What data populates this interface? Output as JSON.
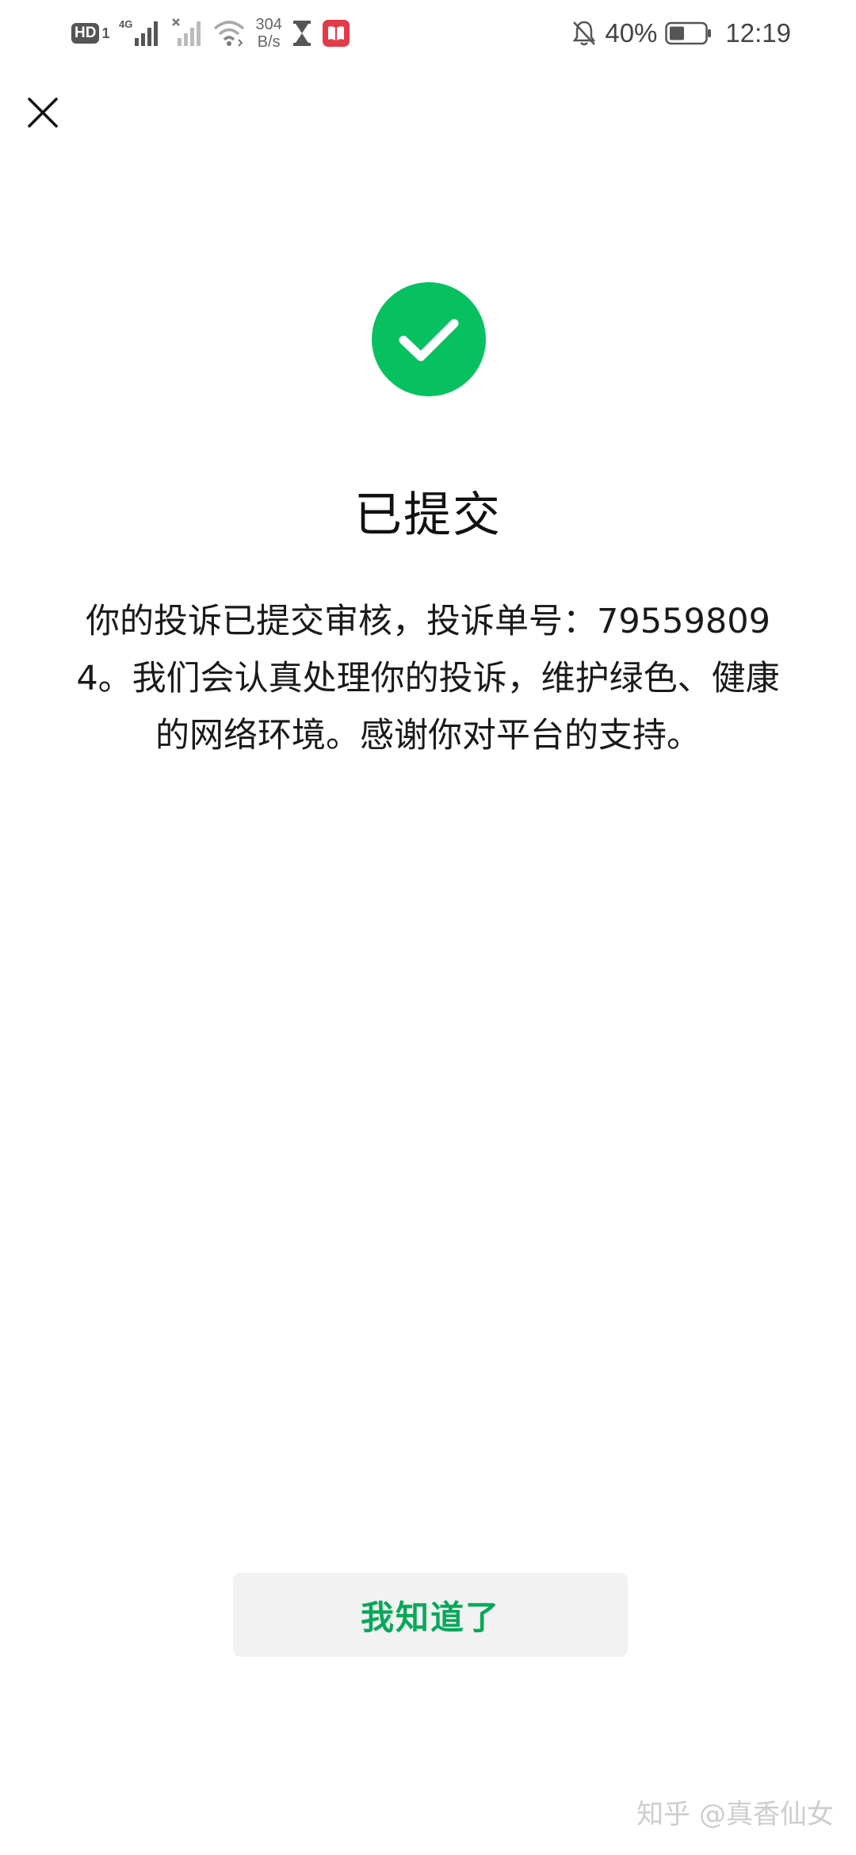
{
  "status_bar": {
    "hd_label": "HD",
    "hd_sub": "1",
    "network_type": "4G",
    "net_speed_value": "304",
    "net_speed_unit": "B/s",
    "battery_percent": "40%",
    "time": "12:19",
    "icons": [
      "hd-icon",
      "signal-4g-icon",
      "signal-no-service-icon",
      "wifi-icon",
      "hourglass-icon",
      "book-app-icon",
      "bell-muted-icon",
      "battery-icon"
    ]
  },
  "header": {
    "close_icon": "close-icon"
  },
  "result": {
    "icon": "check-circle-icon",
    "accent_color": "#07c160",
    "title": "已提交",
    "message": "你的投诉已提交审核，投诉单号：795598094。我们会认真处理你的投诉，维护绿色、健康的网络环境。感谢你对平台的支持。"
  },
  "actions": {
    "confirm_label": "我知道了",
    "confirm_color": "#07a85a"
  },
  "watermark": {
    "text": "知乎 @真香仙女"
  }
}
